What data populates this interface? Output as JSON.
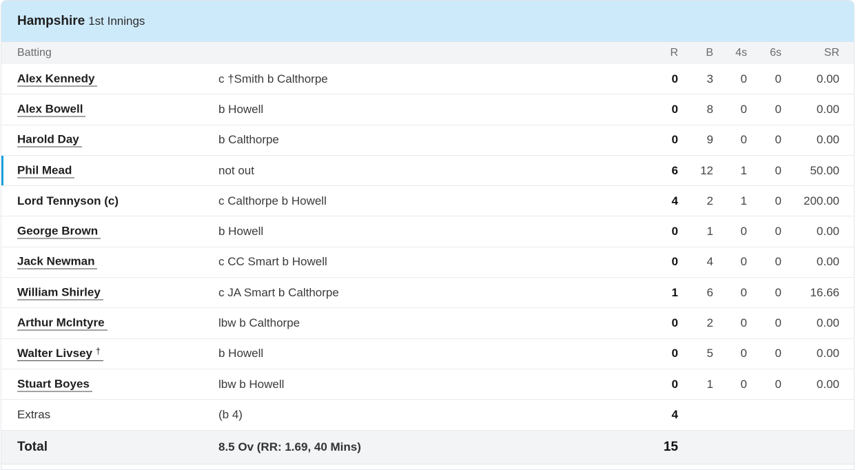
{
  "header": {
    "team": "Hampshire",
    "innings": "1st Innings"
  },
  "columns": {
    "batting": "Batting",
    "r": "R",
    "b": "B",
    "fours": "4s",
    "sixes": "6s",
    "sr": "SR"
  },
  "batters": [
    {
      "name": "Alex Kennedy",
      "dismissal": "c †Smith b Calthorpe",
      "r": "0",
      "b": "3",
      "fours": "0",
      "sixes": "0",
      "sr": "0.00"
    },
    {
      "name": "Alex Bowell",
      "dismissal": "b Howell",
      "r": "0",
      "b": "8",
      "fours": "0",
      "sixes": "0",
      "sr": "0.00"
    },
    {
      "name": "Harold Day",
      "dismissal": "b Calthorpe",
      "r": "0",
      "b": "9",
      "fours": "0",
      "sixes": "0",
      "sr": "0.00"
    },
    {
      "name": "Phil Mead",
      "dismissal": "not out",
      "r": "6",
      "b": "12",
      "fours": "1",
      "sixes": "0",
      "sr": "50.00"
    },
    {
      "name": "Lord Tennyson (c)",
      "dismissal": "c Calthorpe b Howell",
      "r": "4",
      "b": "2",
      "fours": "1",
      "sixes": "0",
      "sr": "200.00"
    },
    {
      "name": "George Brown",
      "dismissal": "b Howell",
      "r": "0",
      "b": "1",
      "fours": "0",
      "sixes": "0",
      "sr": "0.00"
    },
    {
      "name": "Jack Newman",
      "dismissal": "c CC Smart b Howell",
      "r": "0",
      "b": "4",
      "fours": "0",
      "sixes": "0",
      "sr": "0.00"
    },
    {
      "name": "William Shirley",
      "dismissal": "c JA Smart b Calthorpe",
      "r": "1",
      "b": "6",
      "fours": "0",
      "sixes": "0",
      "sr": "16.66"
    },
    {
      "name": "Arthur McIntyre",
      "dismissal": "lbw b Calthorpe",
      "r": "0",
      "b": "2",
      "fours": "0",
      "sixes": "0",
      "sr": "0.00"
    },
    {
      "name": "Walter Livsey",
      "keeper_mark": "†",
      "dismissal": "b Howell",
      "r": "0",
      "b": "5",
      "fours": "0",
      "sixes": "0",
      "sr": "0.00"
    },
    {
      "name": "Stuart Boyes",
      "dismissal": "lbw b Howell",
      "r": "0",
      "b": "1",
      "fours": "0",
      "sixes": "0",
      "sr": "0.00"
    }
  ],
  "extras": {
    "label": "Extras",
    "detail": "(b 4)",
    "value": "4"
  },
  "total": {
    "label": "Total",
    "detail": "8.5 Ov (RR: 1.69, 40 Mins)",
    "value": "15"
  },
  "colors": {
    "header_bg": "#cdeafb",
    "active_accent": "#1aa1db",
    "row_alt_bg": "#f3f4f6"
  }
}
